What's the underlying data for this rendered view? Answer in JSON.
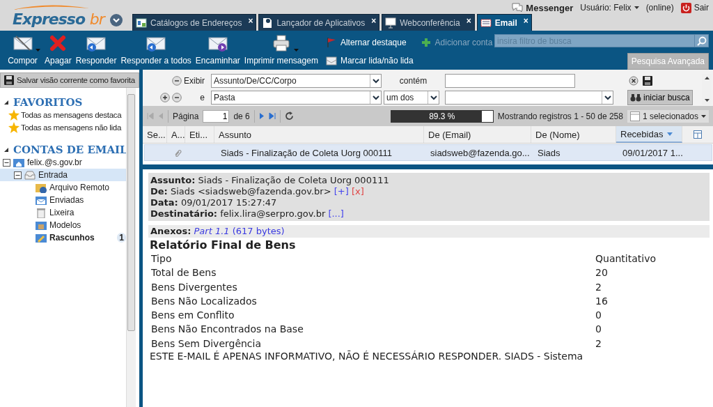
{
  "header": {
    "logo": {
      "word": "Expresso",
      "suffix": "br"
    },
    "messenger": "Messenger",
    "user": "Usuário: Felix",
    "status": "(online)",
    "logout": "Sair"
  },
  "tabs": [
    {
      "label": "Catálogos de Endereços",
      "selected": false,
      "kind": "contacts",
      "close": "×"
    },
    {
      "label": "Lançador de Aplicativos",
      "selected": false,
      "kind": "launcher",
      "close": "×"
    },
    {
      "label": "Webconferência",
      "selected": false,
      "kind": "screen",
      "close": "×"
    },
    {
      "label": "Email",
      "selected": true,
      "kind": "mail",
      "close": "×"
    }
  ],
  "toolbar": {
    "buttons": [
      {
        "label": "Compor",
        "kind": "compose",
        "menu": true
      },
      {
        "label": "Apagar",
        "kind": "delete",
        "menu": false
      },
      {
        "label": "Responder",
        "kind": "reply",
        "menu": false
      },
      {
        "label": "Responder a todos",
        "kind": "reply",
        "menu": false
      },
      {
        "label": "Encaminhar",
        "kind": "forward",
        "menu": false
      },
      {
        "label": "Imprimir mensagem",
        "kind": "print",
        "menu": true
      }
    ],
    "actions": [
      {
        "label": "Alternar destaque",
        "kind": "flag",
        "disabled": false
      },
      {
        "label": "Adicionar conta",
        "kind": "add",
        "disabled": true
      },
      {
        "label": "Marcar lida/não lida",
        "kind": "read",
        "disabled": false
      }
    ],
    "search": {
      "placeholder": "insira filtro de busca"
    },
    "advanced": "Pesquisa Avançada"
  },
  "sidebar": {
    "save_view": "Salvar visão corrente como favorita",
    "favorites": {
      "title": "FAVORITOS",
      "items": [
        "Todas as mensagens destaca",
        "Todas as mensagens não lida"
      ]
    },
    "accounts": {
      "title": "CONTAS DE EMAIL",
      "tree": [
        {
          "label": "felix.@s.gov.br",
          "kind": "account",
          "expanded": true,
          "selected": false,
          "children": [
            {
              "label": "Entrada",
              "kind": "inbox",
              "expanded": true,
              "selected": true,
              "children": [
                {
                  "label": "Arquivo Remoto",
                  "kind": "remote",
                  "selected": false
                },
                {
                  "label": "Enviadas",
                  "kind": "sent",
                  "selected": false
                },
                {
                  "label": "Lixeira",
                  "kind": "trash",
                  "selected": false
                },
                {
                  "label": "Modelos",
                  "kind": "templates",
                  "selected": false
                },
                {
                  "label": "Rascunhos",
                  "kind": "drafts",
                  "selected": false,
                  "count": "1"
                }
              ]
            }
          ]
        }
      ]
    }
  },
  "filter": {
    "rows": [
      {
        "label": "Exibir",
        "field": "Assunto/De/CC/Corpo",
        "operator": "contém",
        "kind": "text"
      },
      {
        "label": "e",
        "field": "Pasta",
        "operator": "um dos",
        "kind": "select"
      }
    ],
    "search_button": "iniciar busca"
  },
  "pager": {
    "page_label": "Página",
    "page": "1",
    "of": "de 6",
    "progress": {
      "level": 0.893,
      "reading": "89.3 %"
    },
    "records": "Mostrando registros 1 - 50 de 258",
    "selected_count": "1 selecionados"
  },
  "table": {
    "columns": [
      {
        "label": "Se...",
        "sorted": false
      },
      {
        "label": "A...",
        "sorted": false
      },
      {
        "label": "Eti...",
        "sorted": false
      },
      {
        "label": "Assunto",
        "sorted": false
      },
      {
        "label": "De (Email)",
        "sorted": false
      },
      {
        "label": "De (Nome)",
        "sorted": false
      },
      {
        "label": "Recebidas",
        "sorted": true
      }
    ],
    "rows": [
      {
        "selected": true,
        "attachment": true,
        "subject": "Siads - Finalização de Coleta Uorg 000111",
        "email": "siadsweb@fazenda.go...",
        "name": "Siads",
        "date": "09/01/2017 1..."
      }
    ]
  },
  "message": {
    "headers": [
      {
        "label": "Assunto:",
        "value": "Siads - Finalização de Coleta Uorg 000111"
      },
      {
        "label": "De:",
        "value": "Siads <siadsweb@fazenda.gov.br>",
        "links": [
          {
            "text": "[+]",
            "kind": "add"
          },
          {
            "text": "[x]",
            "kind": "block"
          }
        ]
      },
      {
        "label": "Data:",
        "value": "09/01/2017 15:27:47"
      },
      {
        "label": "Destinatário:",
        "value": "felix.lira@serpro.gov.br",
        "links": [
          {
            "text": "[...]",
            "kind": "more"
          }
        ]
      }
    ],
    "attachments": {
      "label": "Anexos:",
      "name": "Part 1.1",
      "size": "(617 bytes)"
    },
    "title": "Relatório Final de Bens",
    "report": [
      [
        "Tipo",
        "Quantitativo"
      ],
      [
        "Total de Bens",
        "20"
      ],
      [
        "Bens Divergentes",
        "2"
      ],
      [
        "Bens Não Localizados",
        "16"
      ],
      [
        "Bens em Conflito",
        "0"
      ],
      [
        "Bens Não Encontrados na Base",
        "0"
      ],
      [
        "Bens Sem Divergência",
        "2"
      ]
    ],
    "footer": "ESTE E-MAIL É APENAS INFORMATIVO, NÃO É NECESSÁRIO RESPONDER. SIADS - Sistema"
  }
}
